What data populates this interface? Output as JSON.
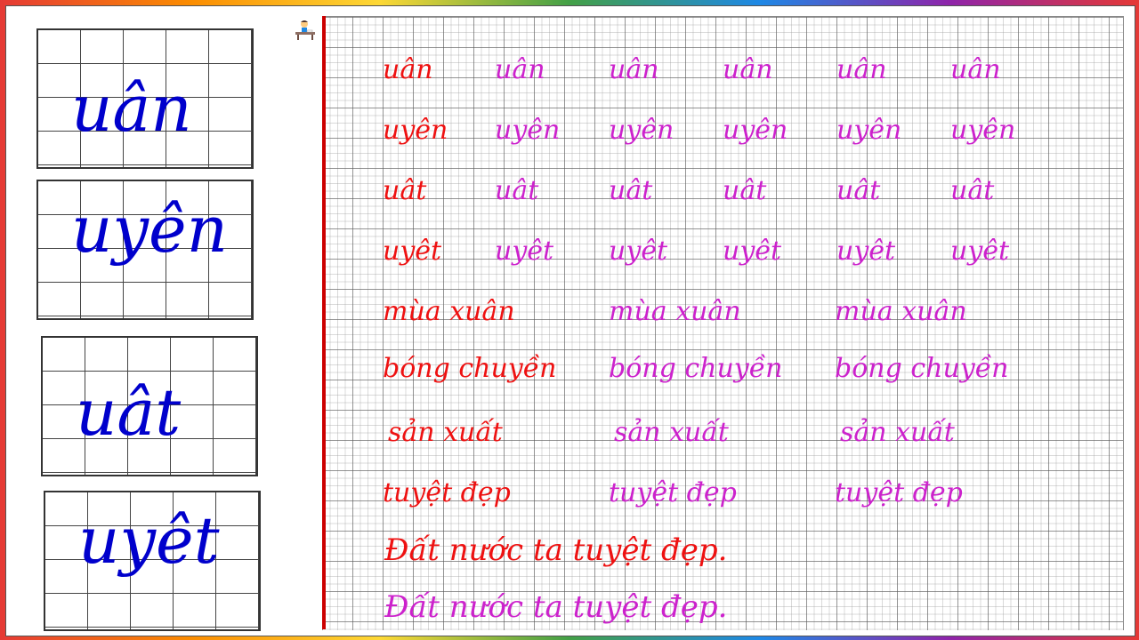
{
  "cards": [
    "uân",
    "uyên",
    "uât",
    "uyêt"
  ],
  "rows": [
    [
      "uân",
      "uân",
      "uân",
      "uân",
      "uân",
      "uân"
    ],
    [
      "uyên",
      "uyên",
      "uyên",
      "uyên",
      "uyên",
      "uyên"
    ],
    [
      "uât",
      "uât",
      "uât",
      "uât",
      "uât",
      "uât"
    ],
    [
      "uyêt",
      "uyêt",
      "uyêt",
      "uyêt",
      "uyêt",
      "uyêt"
    ],
    [
      "mùa xuân",
      "mùa xuân",
      "mùa xuân"
    ],
    [
      "bóng chuyền",
      "bóng chuyền",
      "bóng chuyền"
    ],
    [
      "sản xuất",
      "sản xuất",
      "sản xuất"
    ],
    [
      "tuyệt đẹp",
      "tuyệt đẹp",
      "tuyệt đẹp"
    ]
  ],
  "sentences": [
    "Đất nước ta tuyệt đẹp.",
    "Đất nước ta tuyệt đẹp."
  ],
  "colors": {
    "card_text": "#0000cc",
    "red": "#ee1111",
    "magenta": "#cc22cc",
    "margin_line": "#cc0000"
  },
  "icons": {
    "writer": "child-writing-icon"
  }
}
